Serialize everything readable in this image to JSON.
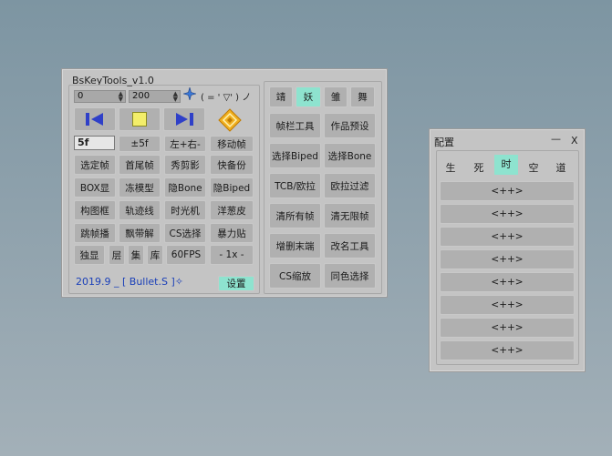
{
  "main": {
    "title": "BsKeyTools_v1.0",
    "spin_start": "0",
    "spin_end": "200",
    "kaomoji": "( = ' ▽' ) ノ",
    "frame_field": "5f",
    "row1": [
      "±5f",
      "左+右-",
      "移动帧"
    ],
    "grid": [
      [
        "选定帧",
        "首尾帧",
        "秀剪影",
        "快备份"
      ],
      [
        "BOX显",
        "冻模型",
        "隐Bone",
        "隐Biped"
      ],
      [
        "构图框",
        "轨迹线",
        "时光机",
        "洋葱皮"
      ],
      [
        "跳帧播",
        "飘带解",
        "CS选择",
        "暴力贴"
      ]
    ],
    "bottom_small": [
      "独显",
      "层",
      "集",
      "库"
    ],
    "fps": "60FPS",
    "speed": "- 1x -",
    "footer": "2019.9 _ [ Bullet.S ]✧",
    "settings": "设置",
    "right_tabs": [
      "靖",
      "妖",
      "雏",
      "舞"
    ],
    "right_grid": [
      [
        "帧栏工具",
        "作品预设"
      ],
      [
        "选择Biped",
        "选择Bone"
      ],
      [
        "TCB/欧拉",
        "欧拉过滤"
      ],
      [
        "清所有帧",
        "清无限帧"
      ],
      [
        "增删末端",
        "改名工具"
      ],
      [
        "CS缩放",
        "同色选择"
      ]
    ]
  },
  "config": {
    "title": "配置",
    "minimize": "—",
    "close": "X",
    "tabs": [
      "生",
      "死",
      "时",
      "空",
      "道"
    ],
    "slots": [
      "<++>",
      "<++>",
      "<++>",
      "<++>",
      "<++>",
      "<++>",
      "<++>",
      "<++>"
    ]
  },
  "colors": {
    "accent": "#8ee3cf",
    "play": "#2f40c8",
    "stop": "#f3ee6a",
    "logo": "#f0b020"
  }
}
